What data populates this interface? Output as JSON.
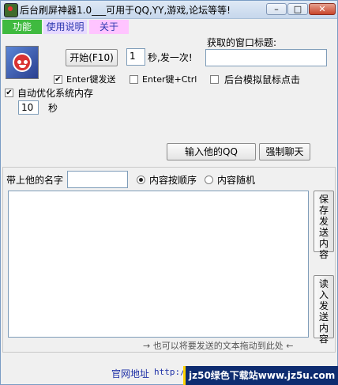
{
  "window": {
    "title": "后台刷屏神器1.0___可用于QQ,YY,游戏,论坛等等!",
    "controls": [
      "–",
      "□",
      "✕"
    ]
  },
  "menu": {
    "tabs": [
      "功能",
      "使用说明",
      "关于"
    ],
    "tab_colors": [
      "#3fba3f",
      "#e7d9ff",
      "#ffc4ff"
    ]
  },
  "controls": {
    "start_button": "开始(F10)",
    "interval_value": "1",
    "interval_suffix": "秒,发一次!",
    "window_title_label": "获取的窗口标题:",
    "window_title_value": "",
    "check_enter_send": {
      "label": "Enter键发送",
      "checked": true
    },
    "check_enter_ctrl": {
      "label": "Enter键+Ctrl",
      "checked": false
    },
    "check_bg_mouse": {
      "label": "后台模拟鼠标点击",
      "checked": false
    },
    "check_auto_optimize": {
      "label": "自动优化系统内存",
      "checked": true
    },
    "optimize_value": "10",
    "optimize_unit": "秒",
    "qq_button": "输入他的QQ",
    "force_chat_button": "强制聊天"
  },
  "message_panel": {
    "name_label": "带上他的名字",
    "name_value": "",
    "radio_order": {
      "label": "内容按顺序",
      "selected": true
    },
    "radio_random": {
      "label": "内容随机",
      "selected": false
    },
    "save_button": "保存发送内容",
    "load_button": "读入发送内容",
    "drag_hint": "→ 也可以将要发送的文本拖动到此处 ←"
  },
  "footer": {
    "site_label": "官网地址",
    "site_url": "http://www.",
    "watermark": "jz50绿色下载站www.jz5u.com"
  },
  "icons": [
    "app-icon",
    "logo-face-icon"
  ]
}
